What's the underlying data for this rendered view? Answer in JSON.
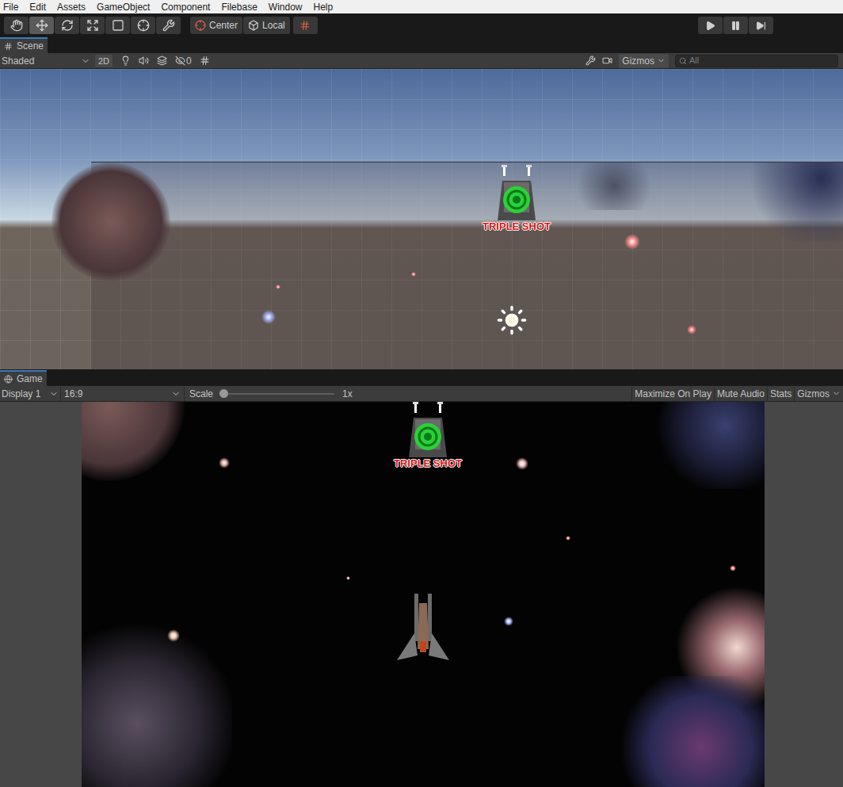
{
  "menu": [
    "File",
    "Edit",
    "Assets",
    "GameObject",
    "Component",
    "Filebase",
    "Window",
    "Help"
  ],
  "toolbar": {
    "tools": [
      {
        "selected": false
      },
      {
        "selected": true
      },
      {
        "selected": false
      },
      {
        "selected": false
      },
      {
        "selected": false
      },
      {
        "selected": false
      },
      {
        "selected": false
      }
    ],
    "pivot": "Center",
    "space": "Local",
    "playback": [
      {
        "selected": false
      },
      {
        "selected": false
      },
      {
        "selected": false
      }
    ]
  },
  "scene": {
    "tab": "Scene",
    "shading": "Shaded",
    "mode2d": "2D",
    "hidden_count": "0",
    "gizmos": "Gizmos",
    "search": {
      "placeholder": "All"
    },
    "powerup_label": "TRIPLE SHOT"
  },
  "game": {
    "tab": "Game",
    "display": "Display 1",
    "aspect": "16:9",
    "scale": {
      "label": "Scale",
      "level": 0,
      "reading": "1x"
    },
    "buttons": [
      {
        "label": "Maximize On Play",
        "selected": false
      },
      {
        "label": "Mute Audio",
        "selected": false
      },
      {
        "label": "Stats",
        "selected": false
      },
      {
        "label": "Gizmos",
        "selected": false
      }
    ],
    "powerup_label": "TRIPLE SHOT"
  }
}
